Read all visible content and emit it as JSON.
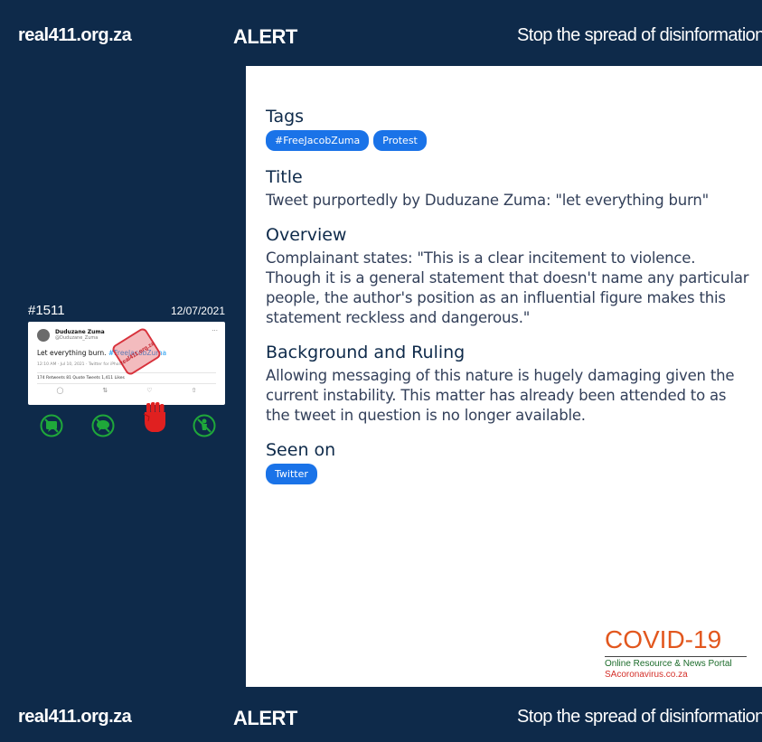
{
  "header": {
    "site": "real411.org.za",
    "alert": "ALERT",
    "slogan": "Stop the spread of disinformation"
  },
  "footer": {
    "site": "real411.org.za",
    "alert": "ALERT",
    "slogan": "Stop the spread of disinformation"
  },
  "card": {
    "id": "#1511",
    "date": "12/07/2021",
    "tweet": {
      "name": "Duduzane Zuma",
      "handle": "@Duduzane_Zuma",
      "text_plain": "Let everything burn. ",
      "text_tag": "#FreeJacobZuma",
      "meta": "12:10 AM · Jul 10, 2021 · Twitter for iPhone",
      "stats": "174 Retweets    81 Quote Tweets    1,411 Likes",
      "stamp_text": "real411.org.za"
    },
    "icons": [
      {
        "name": "misinformation-icon",
        "color": "#1fa83a"
      },
      {
        "name": "hate-speech-icon",
        "color": "#1fa83a"
      },
      {
        "name": "incitement-fist-icon",
        "color": "#e02020"
      },
      {
        "name": "harassment-icon",
        "color": "#1fa83a"
      }
    ]
  },
  "detail": {
    "tags_heading": "Tags",
    "tags": [
      "#FreeJacobZuma",
      "Protest"
    ],
    "title_heading": "Title",
    "title": "Tweet purportedly by Duduzane Zuma: \"let everything burn\"",
    "overview_heading": "Overview",
    "overview": "Complainant states: \"This is a clear incitement to violence. Though it is a general statement that doesn't name any particular people, the author's position as an influential figure makes this statement reckless and dangerous.\"",
    "background_heading": "Background and Ruling",
    "background": "Allowing messaging of this nature is hugely damaging given the current instability. This matter has already been attended to as the tweet in question is no longer available.",
    "seen_heading": "Seen on",
    "seen_on": [
      "Twitter"
    ]
  },
  "logo": {
    "main": "COVID-19",
    "line1": "Online Resource & News Portal",
    "line2": "SAcoronavirus.co.za"
  },
  "colors": {
    "navy": "#0e2a4a",
    "pill_blue": "#1a73e8",
    "green_icon": "#1fa83a",
    "red_icon": "#e02020",
    "covid_orange": "#e2571e"
  }
}
